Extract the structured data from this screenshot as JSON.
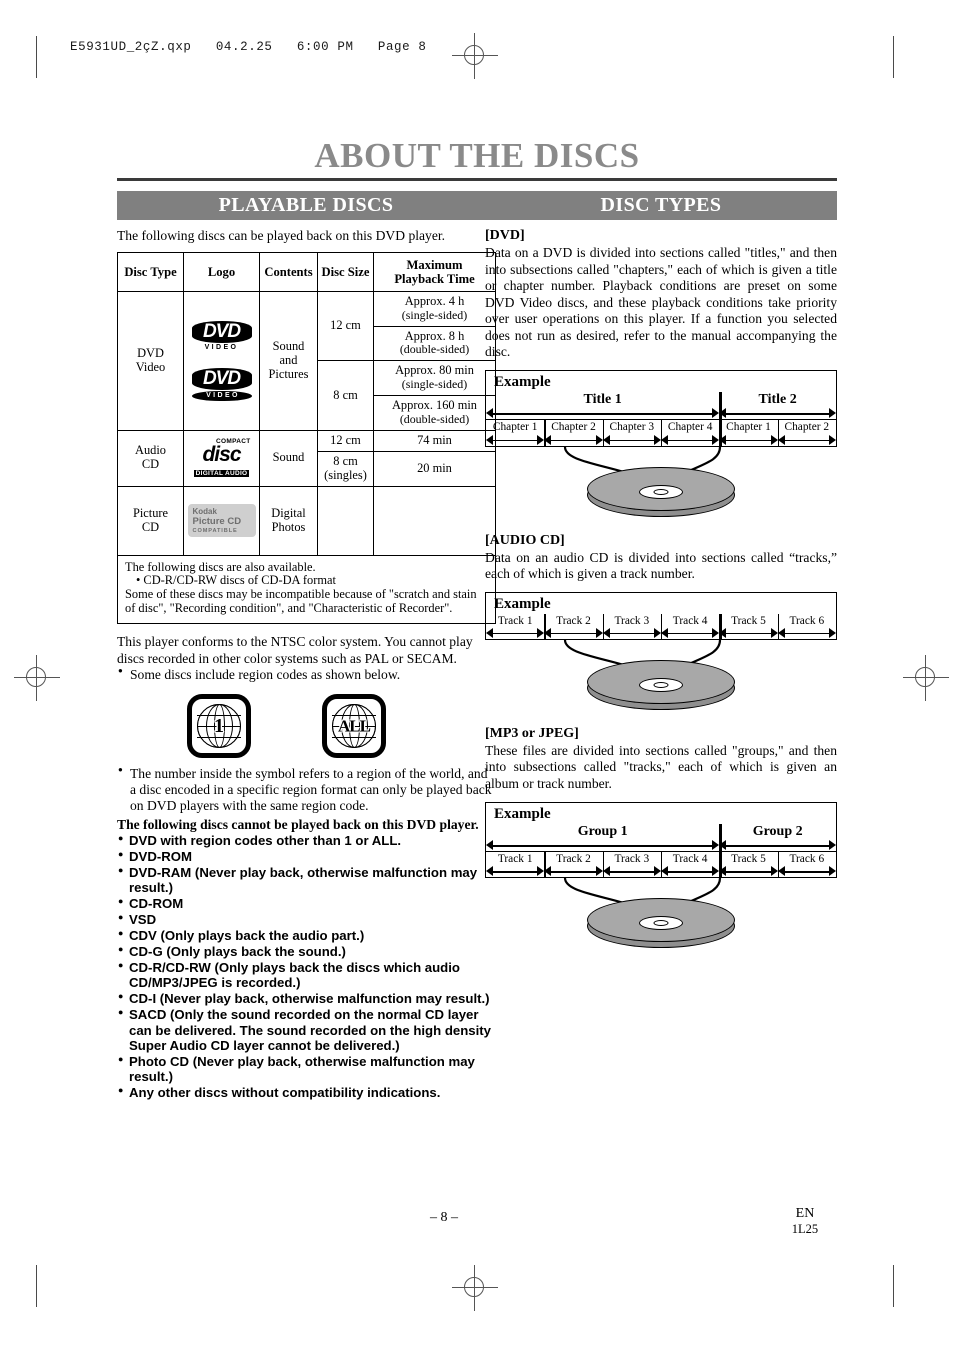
{
  "print_header": "E5931UD_2çZ.qxp   04.2.25   6:00 PM   Page 8",
  "page_title": "ABOUT THE DISCS",
  "left_column": {
    "section_title": "PLAYABLE DISCS",
    "intro": "The following discs can be played back on this DVD player.",
    "table": {
      "headers": [
        "Disc Type",
        "Logo",
        "Contents",
        "Disc Size",
        "Maximum Playback Time"
      ],
      "header_max_line1": "Maximum",
      "header_max_line2": "Playback Time",
      "rows": [
        {
          "disc_type": "DVD Video",
          "disc_type_line1": "DVD",
          "disc_type_line2": "Video",
          "logo": "dvd-video-logo",
          "contents": "Sound and Pictures",
          "contents_line1": "Sound",
          "contents_line2": "and",
          "contents_line3": "Pictures",
          "sizes": [
            {
              "size": "12 cm",
              "times": [
                {
                  "line1": "Approx. 4 h",
                  "line2": "(single-sided)"
                },
                {
                  "line1": "Approx. 8 h",
                  "line2": "(double-sided)"
                }
              ]
            },
            {
              "size": "8 cm",
              "times": [
                {
                  "line1": "Approx. 80 min",
                  "line2": "(single-sided)"
                },
                {
                  "line1": "Approx. 160 min",
                  "line2": "(double-sided)"
                }
              ]
            }
          ]
        },
        {
          "disc_type": "Audio CD",
          "disc_type_line1": "Audio",
          "disc_type_line2": "CD",
          "logo": "compact-disc-digital-audio-logo",
          "contents": "Sound",
          "sizes": [
            {
              "size": "12 cm",
              "size_line2": "",
              "time": "74 min"
            },
            {
              "size": "8 cm",
              "size_line2": "(singles)",
              "time": "20 min"
            }
          ]
        },
        {
          "disc_type": "Picture CD",
          "disc_type_line1": "Picture",
          "disc_type_line2": "CD",
          "logo": "kodak-picture-cd-compatible-logo",
          "contents_line1": "Digital",
          "contents_line2": "Photos",
          "size": "",
          "time": ""
        }
      ],
      "note_line1": "The following discs are also available.",
      "note_line2": "• CD-R/CD-RW discs of CD-DA format",
      "note_line3": "Some of these discs may be incompatible because of \"scratch and stain of disc\", \"Recording condition\", and \"Characteristic of Recorder\"."
    },
    "logos": {
      "dvd_word": "DVD",
      "dvd_video": "VIDEO",
      "cd_top": "COMPACT",
      "cd_disc": "disc",
      "cd_bottom": "DIGITAL AUDIO",
      "kodak_line1": "Kodak",
      "kodak_line2": "Picture CD",
      "kodak_line3": "COMPATIBLE"
    },
    "ntsc_paragraph": "This player conforms to the NTSC color system. You cannot play discs recorded in other color systems such as PAL or SECAM.",
    "region_bullet": "Some discs include region codes as shown below.",
    "region_symbols": [
      {
        "label": "1",
        "name": "region-code-1"
      },
      {
        "label": "ALL",
        "name": "region-code-all"
      }
    ],
    "region_explanation": "The number inside the symbol refers to a region of the world, and a disc encoded in a specific region format can only be played back on DVD players with the same region code.",
    "cannot_play_heading": "The following discs cannot be played back on this DVD player.",
    "cannot_play_list": [
      "DVD with region codes other than 1 or ALL.",
      "DVD-ROM",
      "DVD-RAM (Never play back, otherwise malfunction may result.)",
      "CD-ROM",
      "VSD",
      "CDV (Only plays back the audio part.)",
      "CD-G (Only plays back the sound.)",
      "CD-R/CD-RW (Only plays back the discs which audio CD/MP3/JPEG is recorded.)",
      "CD-I (Never play back, otherwise malfunction may result.)",
      "SACD (Only the sound recorded on the normal CD layer can be delivered. The sound recorded on the high density Super Audio CD layer cannot be delivered.)",
      "Photo CD (Never play back, otherwise malfunction may result.)",
      "Any other discs without compatibility indications."
    ]
  },
  "right_column": {
    "section_title": "DISC TYPES",
    "sections": [
      {
        "heading": "[DVD]",
        "paragraph": "Data on a DVD is divided into sections called \"titles,\" and then into subsections called \"chapters,\" each of which is given a title or chapter number. Playback conditions are preset on some DVD Video discs, and these playback conditions take priority over user operations on this player. If a function you selected does not run as desired, refer to the manual accompanying the disc.",
        "diagram": {
          "example_label": "Example",
          "has_top_band": true,
          "groups": [
            {
              "label": "Title 1",
              "span": 4
            },
            {
              "label": "Title 2",
              "span": 2
            }
          ],
          "segments": [
            "Chapter 1",
            "Chapter 2",
            "Chapter 3",
            "Chapter 4",
            "Chapter 1",
            "Chapter 2"
          ]
        }
      },
      {
        "heading": "[AUDIO CD]",
        "paragraph": "Data on an audio CD is divided into sections called “tracks,” each of which is given a track number.",
        "diagram": {
          "example_label": "Example",
          "has_top_band": false,
          "groups": [],
          "segments": [
            "Track 1",
            "Track 2",
            "Track 3",
            "Track 4",
            "Track 5",
            "Track 6"
          ]
        }
      },
      {
        "heading": "[MP3 or JPEG]",
        "paragraph": "These files are divided into sections called \"groups,\" and then into subsections called \"tracks,\" each of which is given an album or track number.",
        "diagram": {
          "example_label": "Example",
          "has_top_band": true,
          "groups": [
            {
              "label": "Group 1",
              "span": 4
            },
            {
              "label": "Group 2",
              "span": 2
            }
          ],
          "segments": [
            "Track 1",
            "Track 2",
            "Track 3",
            "Track 4",
            "Track 5",
            "Track 6"
          ]
        }
      }
    ]
  },
  "footer": {
    "page_number": "– 8 –",
    "language": "EN",
    "code": "1L25"
  }
}
